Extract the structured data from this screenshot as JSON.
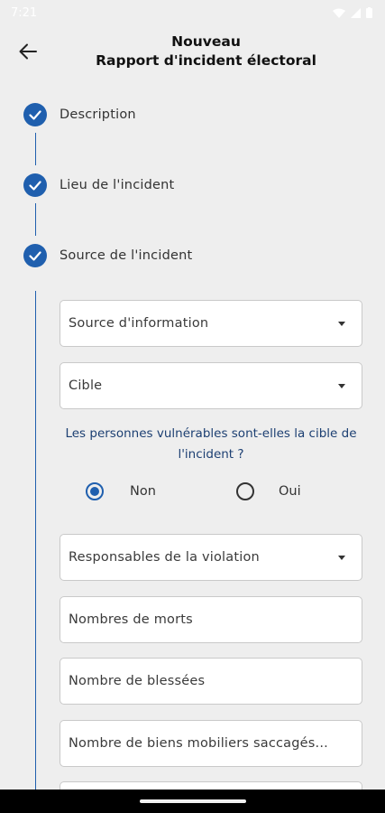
{
  "status_bar": {
    "time": "7:21"
  },
  "header": {
    "back_icon": "arrow-left-icon",
    "title_line1": "Nouveau",
    "title_line2": "Rapport d'incident électoral"
  },
  "steps": [
    {
      "label": "Description",
      "completed": true
    },
    {
      "label": "Lieu de l'incident",
      "completed": true
    },
    {
      "label": "Source de l'incident",
      "completed": true
    }
  ],
  "form": {
    "source_information": {
      "placeholder": "Source d'information",
      "type": "dropdown"
    },
    "cible": {
      "placeholder": "Cible",
      "type": "dropdown"
    },
    "question": "Les personnes vulnérables sont-elles la cible de l'incident ?",
    "radio_options": [
      {
        "label": "Non",
        "selected": true
      },
      {
        "label": "Oui",
        "selected": false
      }
    ],
    "responsables": {
      "placeholder": "Responsables de la violation",
      "type": "dropdown"
    },
    "nombre_morts": {
      "placeholder": "Nombres de morts"
    },
    "nombre_blessees": {
      "placeholder": "Nombre de blessées"
    },
    "biens_mobiliers": {
      "placeholder": "Nombre de biens mobiliers saccagés..."
    }
  },
  "colors": {
    "accent": "#1f5fae",
    "question_text": "#1c3f72",
    "background": "#eeeeee"
  }
}
